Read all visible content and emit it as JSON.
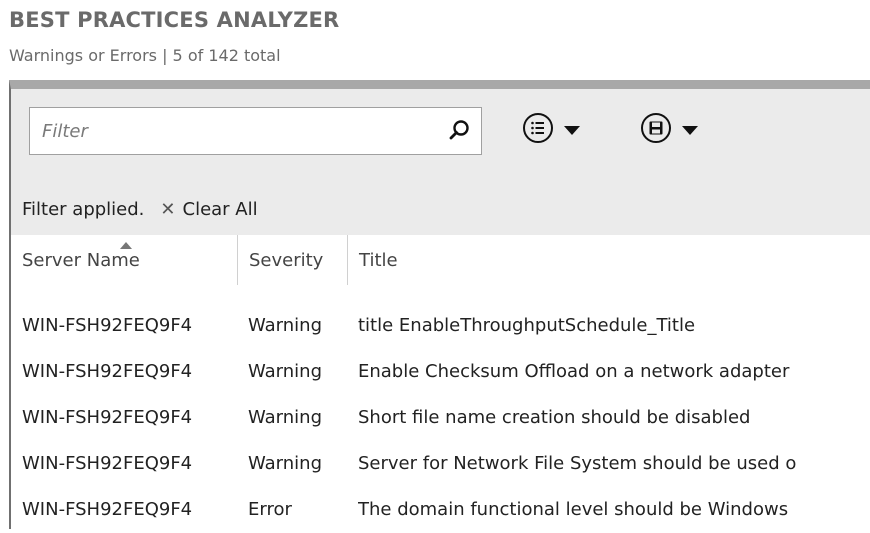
{
  "app": {
    "title": "BEST PRACTICES ANALYZER",
    "subtitle": "Warnings or Errors | 5 of 142 total"
  },
  "toolbar": {
    "filter_placeholder": "Filter",
    "search_icon": "search-icon",
    "view_menu_icon": "list-menu-icon",
    "save_menu_icon": "save-menu-icon",
    "status_text": "Filter applied.",
    "clear_all_label": "Clear All",
    "clear_icon": "close-icon"
  },
  "table": {
    "columns": [
      {
        "label": "Server Name",
        "sorted": "ascending"
      },
      {
        "label": "Severity"
      },
      {
        "label": "Title"
      }
    ],
    "rows": [
      {
        "server": "WIN-FSH92FEQ9F4",
        "severity": "Warning",
        "title": "title EnableThroughputSchedule_Title"
      },
      {
        "server": "WIN-FSH92FEQ9F4",
        "severity": "Warning",
        "title": "Enable Checksum Offload on a network adapter"
      },
      {
        "server": "WIN-FSH92FEQ9F4",
        "severity": "Warning",
        "title": "Short file name creation should be disabled"
      },
      {
        "server": "WIN-FSH92FEQ9F4",
        "severity": "Warning",
        "title": "Server for Network File System should be used o"
      },
      {
        "server": "WIN-FSH92FEQ9F4",
        "severity": "Error",
        "title": "The domain functional level should be Windows"
      }
    ]
  },
  "colors": {
    "toolbar_bg": "#ebebeb",
    "panel_border": "#a8a8a8",
    "heading_text": "#6a6a6a"
  }
}
